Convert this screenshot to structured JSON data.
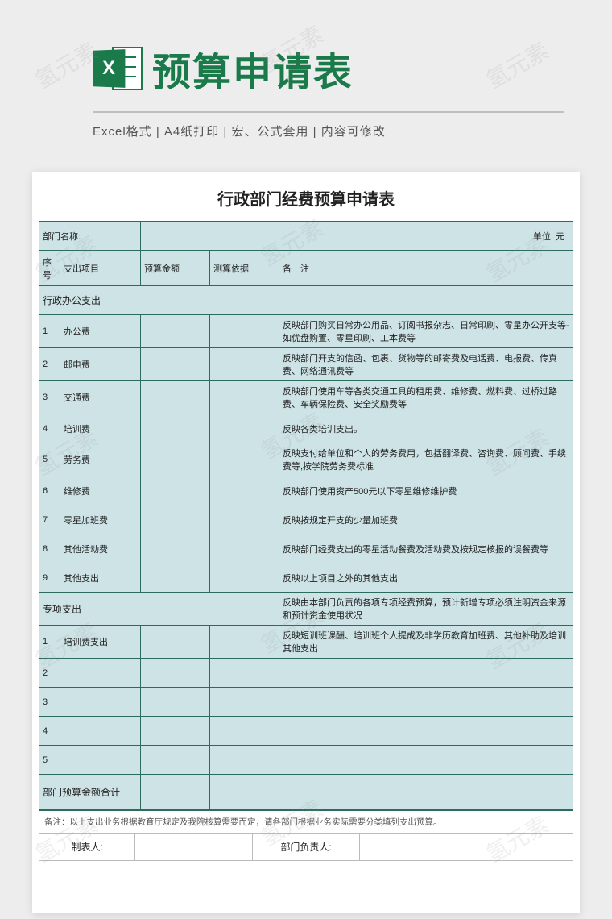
{
  "header": {
    "title": "预算申请表",
    "icon_letter": "X",
    "subtitle": "Excel格式 |  A4纸打印  |  宏、公式套用  |  内容可修改"
  },
  "watermark": "氢元素",
  "sheet": {
    "title": "行政部门经费预算申请表",
    "dept_label": "部门名称:",
    "unit_label": "单位: 元",
    "columns": {
      "num": "序号",
      "item": "支出项目",
      "amount": "预算金额",
      "basis": "测算依据",
      "remark": "备　注"
    },
    "section1": "行政办公支出",
    "rows1": [
      {
        "n": "1",
        "item": "办公费",
        "remark": "反映部门购买日常办公用品、订阅书报杂志、日常印刷、零星办公开支等-如优盘购置、零星印刷、工本费等"
      },
      {
        "n": "2",
        "item": "邮电费",
        "remark": "反映部门开支的信函、包裹、货物等的邮寄费及电话费、电报费、传真费、网络通讯费等"
      },
      {
        "n": "3",
        "item": "交通费",
        "remark": "反映部门使用车等各类交通工具的租用费、维修费、燃料费、过桥过路费、车辆保险费、安全奖励费等"
      },
      {
        "n": "4",
        "item": "培训费",
        "remark": "反映各类培训支出。"
      },
      {
        "n": "5",
        "item": "劳务费",
        "remark": "反映支付给单位和个人的劳务费用，包括翻译费、咨询费、顾问费、手续费等,按学院劳务费标准"
      },
      {
        "n": "6",
        "item": "维修费",
        "remark": "反映部门使用资产500元以下零星维修维护费"
      },
      {
        "n": "7",
        "item": "零星加班费",
        "remark": "反映按规定开支的少量加班费"
      },
      {
        "n": "8",
        "item": "其他活动费",
        "remark": "反映部门经费支出的零星活动餐费及活动费及按规定核报的误餐费等"
      },
      {
        "n": "9",
        "item": "其他支出",
        "remark": "反映以上项目之外的其他支出"
      }
    ],
    "section2": "专项支出",
    "section2_remark": "反映由本部门负责的各项专项经费预算，预计新增专项必须注明资金来源和预计资金使用状况",
    "rows2": [
      {
        "n": "1",
        "item": "培训费支出",
        "remark": "反映短训班课酬、培训班个人提成及非学历教育加班费、其他补助及培训其他支出"
      },
      {
        "n": "2",
        "item": "",
        "remark": ""
      },
      {
        "n": "3",
        "item": "",
        "remark": ""
      },
      {
        "n": "4",
        "item": "",
        "remark": ""
      },
      {
        "n": "5",
        "item": "",
        "remark": ""
      }
    ],
    "total_label": "部门预算金额合计",
    "footer_note": "备注：以上支出业务根据教育厅规定及我院核算需要而定，请各部门根据业务实际需要分类填列支出预算。",
    "sign": {
      "maker": "制表人:",
      "leader": "部门负责人:"
    }
  }
}
